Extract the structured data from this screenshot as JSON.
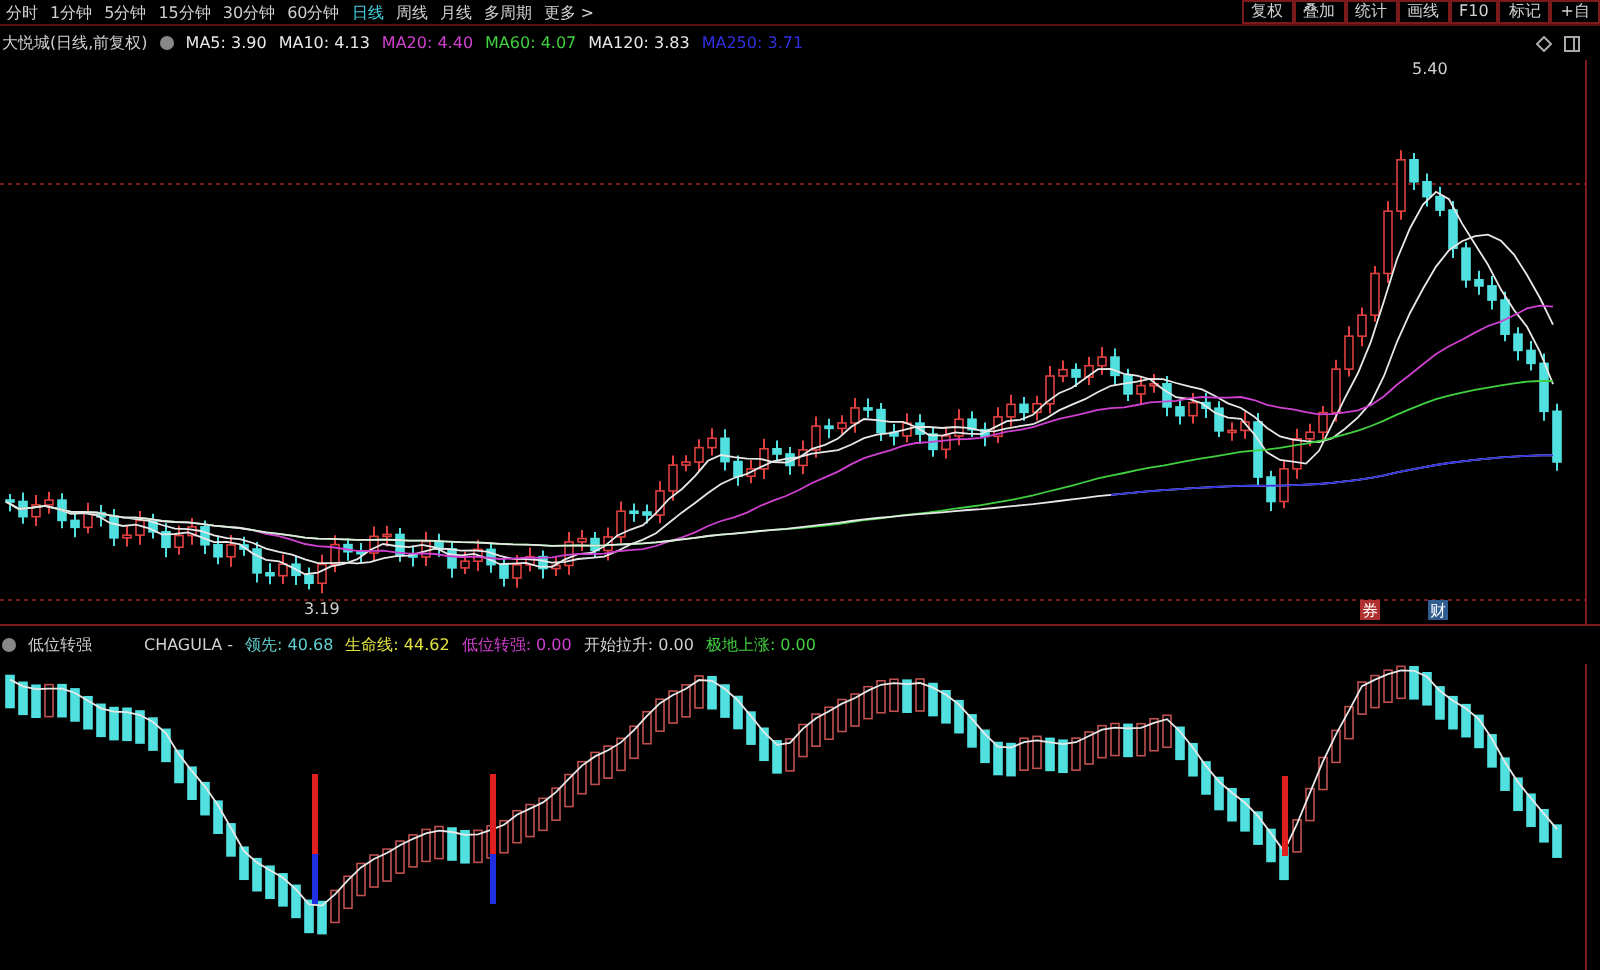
{
  "toolbar": {
    "periods": [
      {
        "label": "分时",
        "selected": false
      },
      {
        "label": "1分钟",
        "selected": false
      },
      {
        "label": "5分钟",
        "selected": false
      },
      {
        "label": "15分钟",
        "selected": false
      },
      {
        "label": "30分钟",
        "selected": false
      },
      {
        "label": "60分钟",
        "selected": false
      },
      {
        "label": "日线",
        "selected": true
      },
      {
        "label": "周线",
        "selected": false
      },
      {
        "label": "月线",
        "selected": false
      },
      {
        "label": "多周期",
        "selected": false
      },
      {
        "label": "更多 >",
        "selected": false
      }
    ],
    "buttons": [
      "复权",
      "叠加",
      "统计",
      "画线",
      "F10",
      "标记",
      "+自"
    ]
  },
  "price_chart": {
    "title": "大悦城(日线,前复权)",
    "moving_averages": [
      {
        "label": "MA5: 3.90",
        "color": "#e8e8e8"
      },
      {
        "label": "MA10: 4.13",
        "color": "#e8e8e8"
      },
      {
        "label": "MA20: 4.40",
        "color": "#d040d0"
      },
      {
        "label": "MA60: 4.07",
        "color": "#40d040"
      },
      {
        "label": "MA120: 3.83",
        "color": "#e8e8e8"
      },
      {
        "label": "MA250: 3.71",
        "color": "#3030e0"
      }
    ],
    "high_label": "5.40",
    "low_label": "3.19",
    "badges": [
      {
        "label": "券",
        "color": "#b03030"
      },
      {
        "label": "财",
        "color": "#305c90"
      }
    ]
  },
  "indicator": {
    "title": "低位转强",
    "formula": "CHAGULA -",
    "values": [
      {
        "label": "领先: 40.68",
        "color": "#60d0d0"
      },
      {
        "label": "生命线: 44.62",
        "color": "#e0e040"
      },
      {
        "label": "低位转强: 0.00",
        "color": "#d040d0"
      },
      {
        "label": "开始拉升: 0.00",
        "color": "#d0d0d0"
      },
      {
        "label": "极地上涨: 0.00",
        "color": "#40d040"
      }
    ]
  }
}
